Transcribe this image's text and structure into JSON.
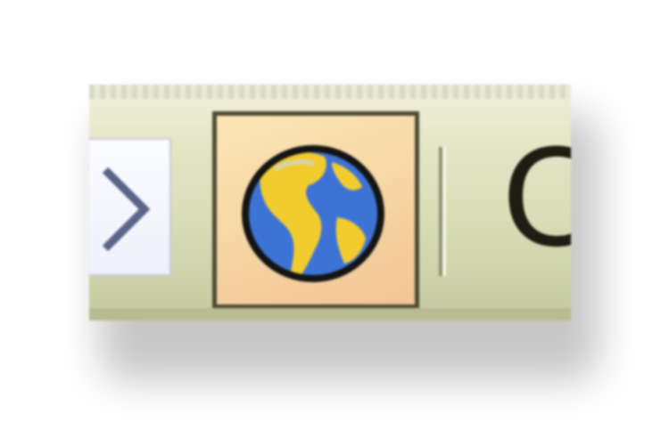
{
  "toolbar": {
    "chevron_icon": "chevron-right-icon",
    "globe_icon": "globe-icon",
    "partial_label": "C"
  },
  "colors": {
    "toolbar_bg": "#dfe2c0",
    "button_hover_bg": "#f7d8a6",
    "button_border": "#4e4a34",
    "globe_ocean": "#3e73d6",
    "globe_land": "#f2cc2e",
    "text": "#1d1d12"
  }
}
